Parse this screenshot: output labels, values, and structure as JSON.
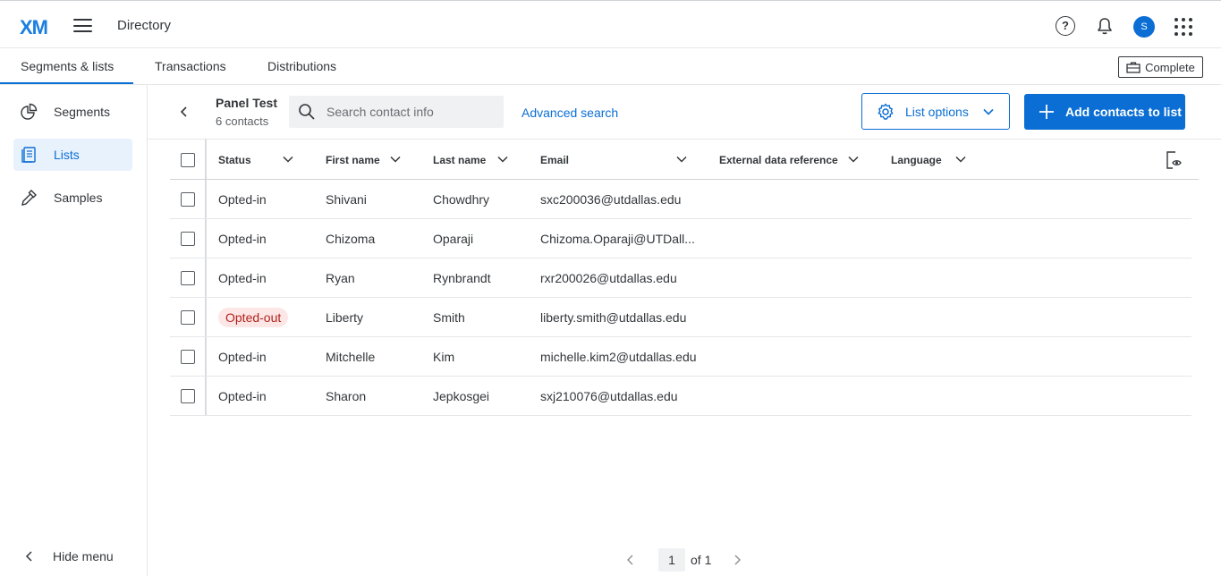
{
  "header": {
    "logo": "XM",
    "app_title": "Directory",
    "help": "?",
    "avatar_initial": "S",
    "icons": [
      "hamburger-icon",
      "help-icon",
      "bell-icon",
      "apps-grid-icon"
    ]
  },
  "tabs": [
    {
      "label": "Segments & lists",
      "active": true
    },
    {
      "label": "Transactions",
      "active": false
    },
    {
      "label": "Distributions",
      "active": false
    }
  ],
  "complete_button": "Complete",
  "sidebar": {
    "items": [
      {
        "label": "Segments",
        "icon": "segments-pie-icon",
        "active": false
      },
      {
        "label": "Lists",
        "icon": "lists-icon",
        "active": true
      },
      {
        "label": "Samples",
        "icon": "samples-dropper-icon",
        "active": false
      }
    ],
    "hide_menu": "Hide menu"
  },
  "list": {
    "name": "Panel Test",
    "count": "6 contacts"
  },
  "search": {
    "placeholder": "Search contact info",
    "advanced": "Advanced search"
  },
  "list_options": "List options",
  "add_contacts": "Add contacts to list",
  "table": {
    "columns": [
      "Status",
      "First name",
      "Last name",
      "Email",
      "External data reference",
      "Language"
    ],
    "rows": [
      {
        "status": "Opted-in",
        "first": "Shivani",
        "last": "Chowdhry",
        "email": "sxc200036@utdallas.edu"
      },
      {
        "status": "Opted-in",
        "first": "Chizoma",
        "last": "Oparaji",
        "email": "Chizoma.Oparaji@UTDall..."
      },
      {
        "status": "Opted-in",
        "first": "Ryan",
        "last": "Rynbrandt",
        "email": "rxr200026@utdallas.edu"
      },
      {
        "status": "Opted-out",
        "first": "Liberty",
        "last": "Smith",
        "email": "liberty.smith@utdallas.edu"
      },
      {
        "status": "Opted-in",
        "first": "Mitchelle",
        "last": "Kim",
        "email": "michelle.kim2@utdallas.edu"
      },
      {
        "status": "Opted-in",
        "first": "Sharon",
        "last": "Jepkosgei",
        "email": "sxj210076@utdallas.edu"
      }
    ]
  },
  "pagination": {
    "current": "1",
    "of_label": "of 1"
  },
  "colors": {
    "accent": "#0b6ed4",
    "opted_out_bg": "#fde7e6",
    "opted_out_text": "#b0231c"
  }
}
